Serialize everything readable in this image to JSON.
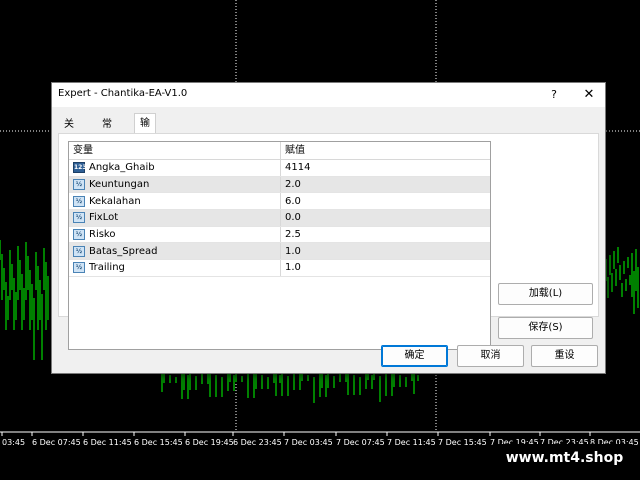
{
  "background_chart": {
    "bar_color": "#00ff00",
    "grid_color": "#ffffff",
    "time_labels": [
      "03:45",
      "6 Dec 07:45",
      "6 Dec 11:45",
      "6 Dec 15:45",
      "6 Dec 19:45",
      "6 Dec 23:45",
      "7 Dec 03:45",
      "7 Dec 07:45",
      "7 Dec 11:45",
      "7 Dec 15:45",
      "7 Dec 19:45",
      "7 Dec 23:45",
      "8 Dec 03:45"
    ]
  },
  "watermark": "www.mt4.shop",
  "dialog": {
    "title": "Expert - Chantika-EA-V1.0",
    "help_label": "?",
    "close_label": "✕",
    "tabs": [
      {
        "label": "关于",
        "active": false
      },
      {
        "label": "常用",
        "active": false
      },
      {
        "label": "输入参数",
        "active": true
      }
    ],
    "grid": {
      "headers": {
        "name": "变量",
        "value": "赋值"
      },
      "rows": [
        {
          "name": "Angka_Ghaib",
          "value": "4114",
          "icon": "int-icon",
          "icon_text": "123"
        },
        {
          "name": "Keuntungan",
          "value": "2.0",
          "icon": "double-icon",
          "icon_text": "½"
        },
        {
          "name": "Kekalahan",
          "value": "6.0",
          "icon": "double-icon",
          "icon_text": "½"
        },
        {
          "name": "FixLot",
          "value": "0.0",
          "icon": "double-icon",
          "icon_text": "½"
        },
        {
          "name": "Risko",
          "value": "2.5",
          "icon": "double-icon",
          "icon_text": "½"
        },
        {
          "name": "Batas_Spread",
          "value": "1.0",
          "icon": "double-icon",
          "icon_text": "½"
        },
        {
          "name": "Trailing",
          "value": "1.0",
          "icon": "double-icon",
          "icon_text": "½"
        }
      ]
    },
    "buttons": {
      "load": "加载(L)",
      "save": "保存(S)",
      "ok": "确定",
      "cancel": "取消",
      "reset": "重设"
    }
  }
}
